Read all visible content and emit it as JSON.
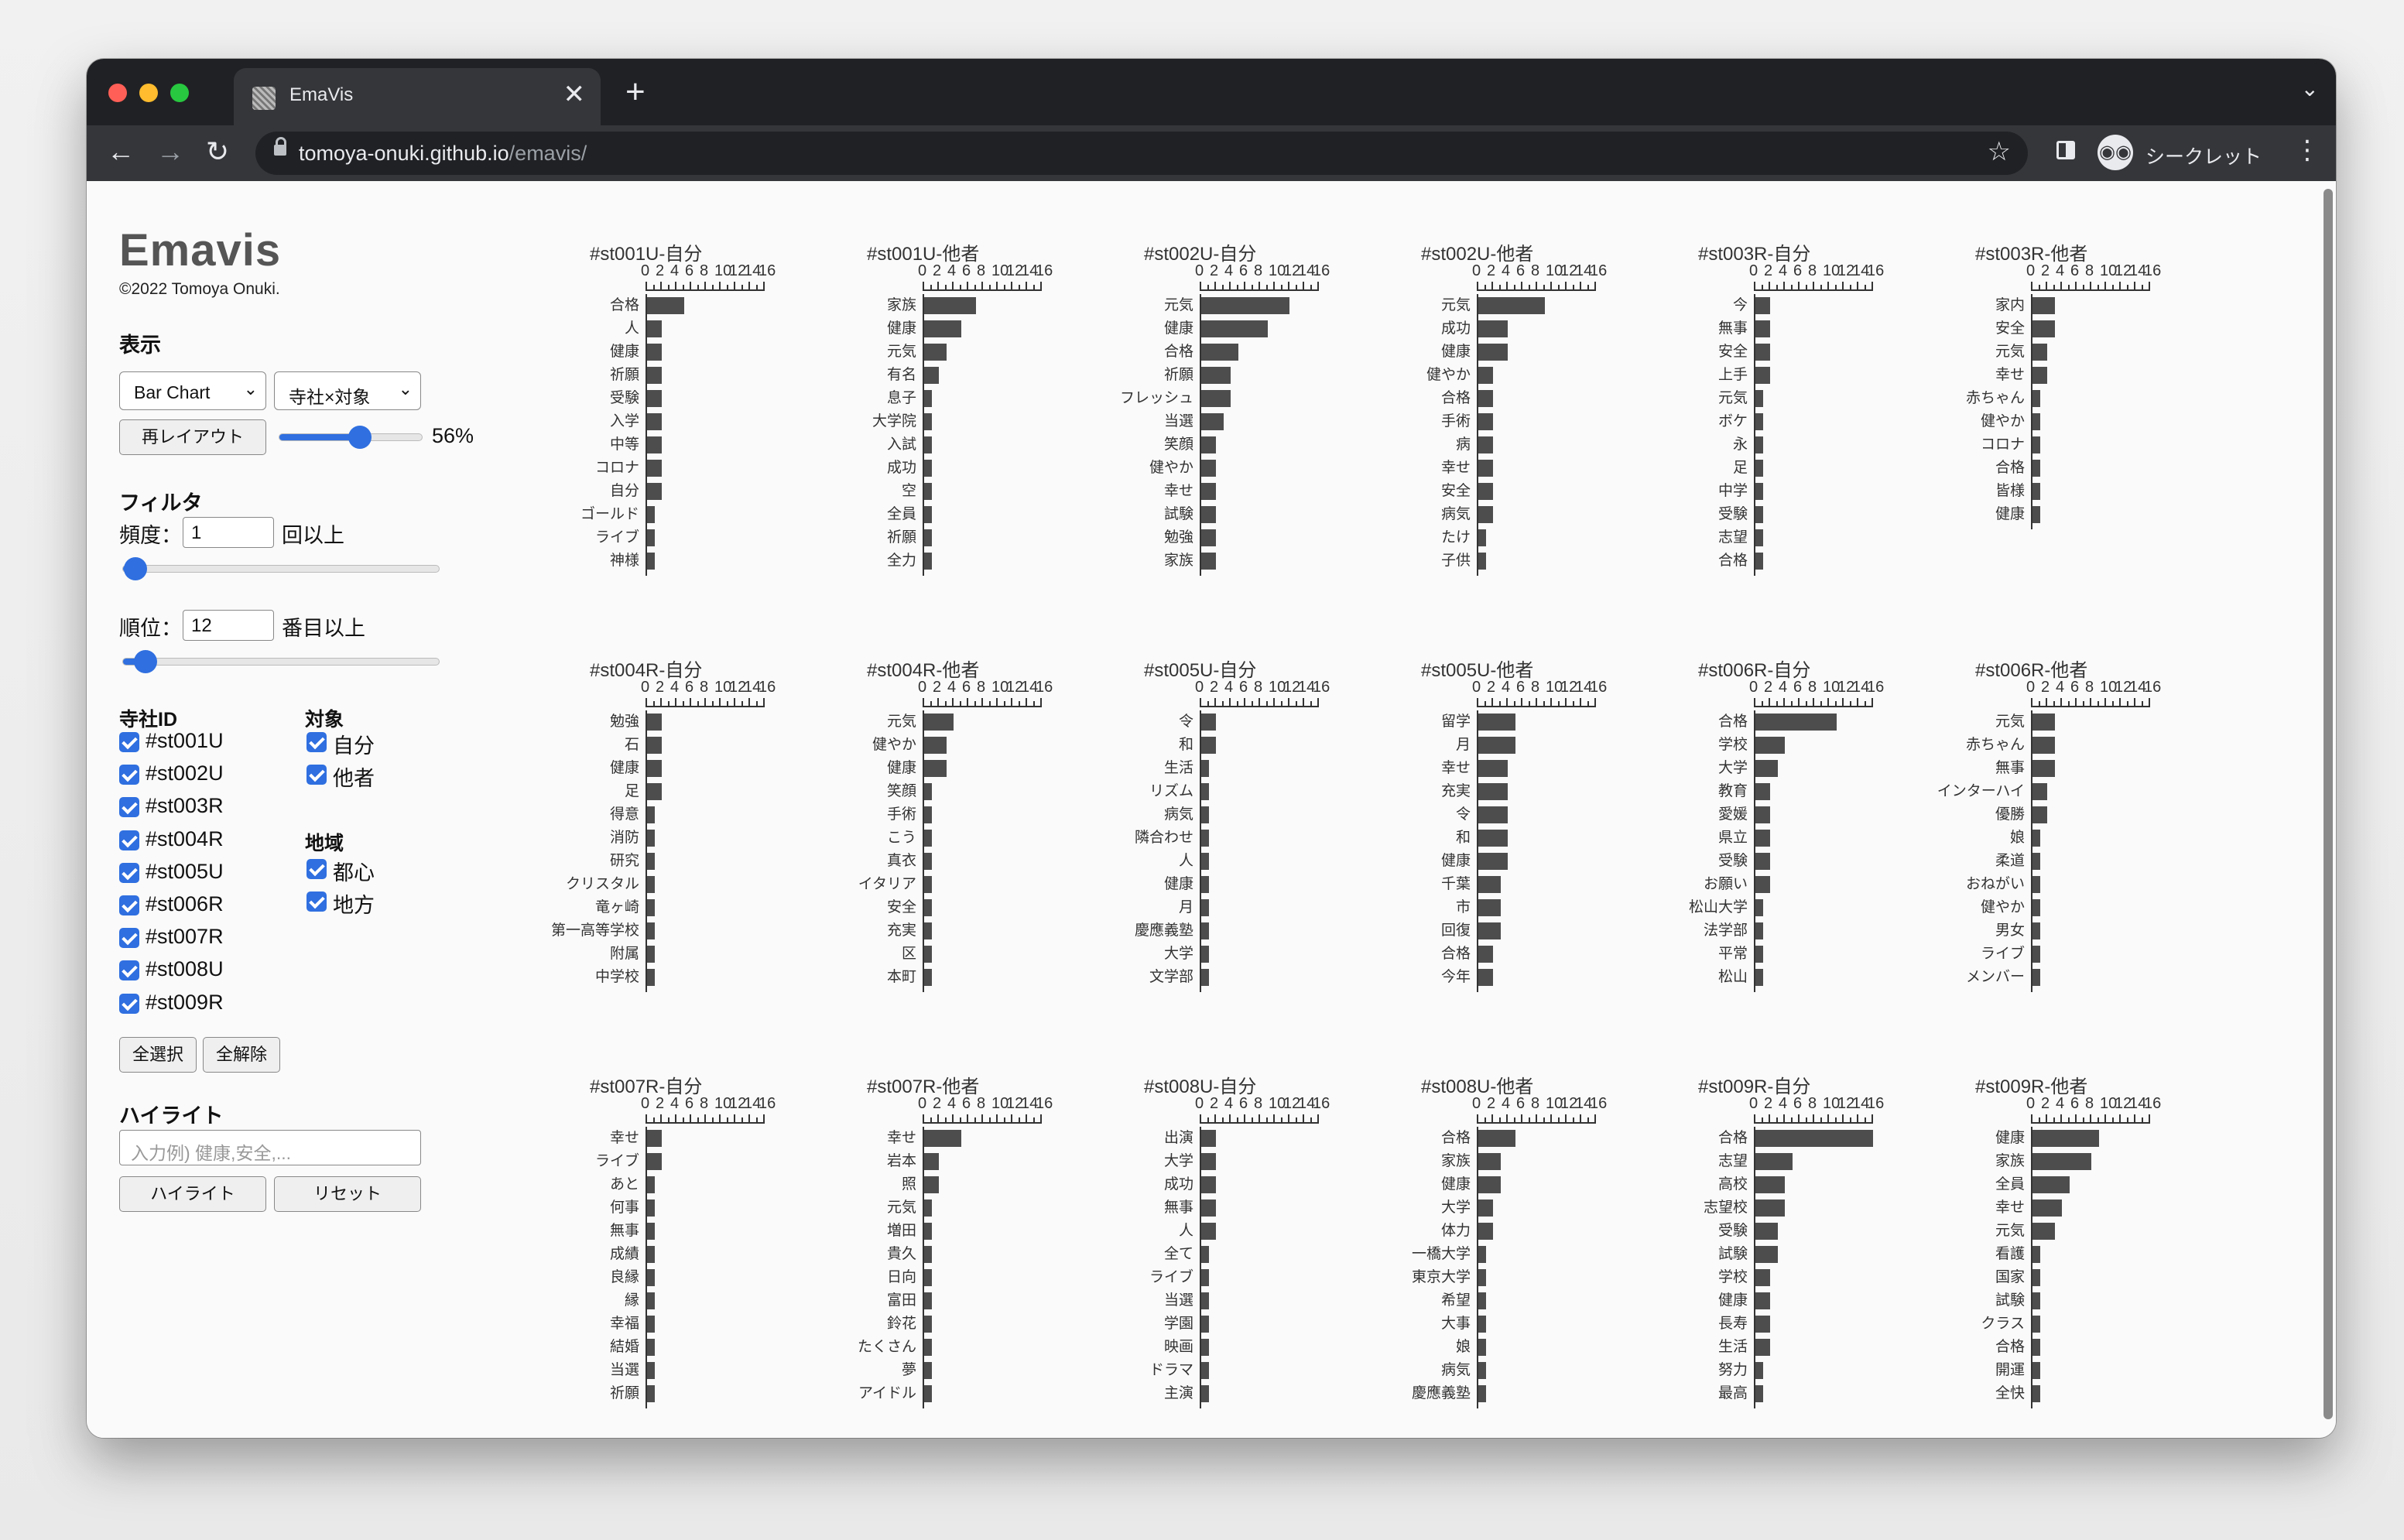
{
  "browser": {
    "tab_title": "EmaVis",
    "tab_close": "✕",
    "new_tab": "+",
    "tab_list": "⌄",
    "back": "←",
    "forward": "→",
    "reload": "↻",
    "url_host": "tomoya-onuki.github.io",
    "url_path": "/emavis/",
    "star": "☆",
    "incognito_icon": "◉◉",
    "incognito_label": "シークレット",
    "menu": "⋮",
    "colors": {
      "frame": "#202124",
      "toolbar": "#35363a",
      "close": "#ff5f57",
      "min": "#febc2e",
      "max": "#28c840"
    }
  },
  "controls": {
    "title": "Emavis",
    "copyright": "©2022 Tomoya Onuki.",
    "display_label": "表示",
    "chart_type": "Bar Chart",
    "grouping": "寺社×対象",
    "relayout_button": "再レイアウト",
    "zoom_value": 0.56,
    "zoom_text": "56%",
    "filter_label": "フィルタ",
    "freq_label": "頻度：",
    "freq_value": "1",
    "freq_suffix": "回以上",
    "freq_slider": 0.04,
    "rank_label": "順位：",
    "rank_value": "12",
    "rank_suffix": "番目以上",
    "rank_slider": 0.07,
    "shrine_header": "寺社ID",
    "shrines": [
      "#st001U",
      "#st002U",
      "#st003R",
      "#st004R",
      "#st005U",
      "#st006R",
      "#st007R",
      "#st008U",
      "#st009R"
    ],
    "target_header": "対象",
    "targets": [
      "自分",
      "他者"
    ],
    "region_header": "地域",
    "regions": [
      "都心",
      "地方"
    ],
    "select_all": "全選択",
    "clear_all": "全解除",
    "highlight_label": "ハイライト",
    "highlight_placeholder": "入力例) 健康,安全,...",
    "highlight_button": "ハイライト",
    "reset_button": "リセット"
  },
  "chart_data": {
    "type": "bar",
    "orientation": "horizontal",
    "x_ticks": [
      "0",
      "2",
      "4",
      "6",
      "8",
      "10",
      "12",
      "14",
      "16"
    ],
    "xlim": [
      0,
      16
    ],
    "bar_color": "#4d4d4d",
    "charts": [
      {
        "title": "#st001U-自分",
        "categories": [
          "合格",
          "人",
          "健康",
          "祈願",
          "受験",
          "入学",
          "中等",
          "コロナ",
          "自分",
          "ゴールド",
          "ライブ",
          "神様"
        ],
        "values": [
          5,
          2,
          2,
          2,
          2,
          2,
          2,
          2,
          2,
          1,
          1,
          1
        ]
      },
      {
        "title": "#st001U-他者",
        "categories": [
          "家族",
          "健康",
          "元気",
          "有名",
          "息子",
          "大学院",
          "入試",
          "成功",
          "空",
          "全員",
          "祈願",
          "全力"
        ],
        "values": [
          7,
          5,
          3,
          2,
          1,
          1,
          1,
          1,
          1,
          1,
          1,
          1
        ]
      },
      {
        "title": "#st002U-自分",
        "categories": [
          "元気",
          "健康",
          "合格",
          "祈願",
          "フレッシュ",
          "当選",
          "笑顔",
          "健やか",
          "幸せ",
          "試験",
          "勉強",
          "家族"
        ],
        "values": [
          12,
          9,
          5,
          4,
          4,
          3,
          2,
          2,
          2,
          2,
          2,
          2
        ]
      },
      {
        "title": "#st002U-他者",
        "categories": [
          "元気",
          "成功",
          "健康",
          "健やか",
          "合格",
          "手術",
          "病",
          "幸せ",
          "安全",
          "病気",
          "たけ",
          "子供"
        ],
        "values": [
          9,
          4,
          4,
          2,
          2,
          2,
          2,
          2,
          2,
          2,
          1,
          1
        ]
      },
      {
        "title": "#st003R-自分",
        "categories": [
          "今",
          "無事",
          "安全",
          "上手",
          "元気",
          "ボケ",
          "永",
          "足",
          "中学",
          "受験",
          "志望",
          "合格"
        ],
        "values": [
          2,
          2,
          2,
          2,
          1,
          1,
          1,
          1,
          1,
          1,
          1,
          1
        ]
      },
      {
        "title": "#st003R-他者",
        "categories": [
          "家内",
          "安全",
          "元気",
          "幸せ",
          "赤ちゃん",
          "健やか",
          "コロナ",
          "合格",
          "皆様",
          "健康"
        ],
        "values": [
          3,
          3,
          2,
          2,
          1,
          1,
          1,
          1,
          1,
          1
        ]
      },
      {
        "title": "#st004R-自分",
        "categories": [
          "勉強",
          "石",
          "健康",
          "足",
          "得意",
          "消防",
          "研究",
          "クリスタル",
          "竜ヶ崎",
          "第一高等学校",
          "附属",
          "中学校"
        ],
        "values": [
          2,
          2,
          2,
          2,
          1,
          1,
          1,
          1,
          1,
          1,
          1,
          1
        ]
      },
      {
        "title": "#st004R-他者",
        "categories": [
          "元気",
          "健やか",
          "健康",
          "笑顔",
          "手術",
          "こう",
          "真衣",
          "イタリア",
          "安全",
          "充実",
          "区",
          "本町"
        ],
        "values": [
          4,
          3,
          3,
          1,
          1,
          1,
          1,
          1,
          1,
          1,
          1,
          1
        ]
      },
      {
        "title": "#st005U-自分",
        "categories": [
          "令",
          "和",
          "生活",
          "リズム",
          "病気",
          "隣合わせ",
          "人",
          "健康",
          "月",
          "慶應義塾",
          "大学",
          "文学部"
        ],
        "values": [
          2,
          2,
          1,
          1,
          1,
          1,
          1,
          1,
          1,
          1,
          1,
          1
        ]
      },
      {
        "title": "#st005U-他者",
        "categories": [
          "留学",
          "月",
          "幸せ",
          "充実",
          "令",
          "和",
          "健康",
          "千葉",
          "市",
          "回復",
          "合格",
          "今年"
        ],
        "values": [
          5,
          5,
          4,
          4,
          4,
          4,
          4,
          3,
          3,
          3,
          2,
          2
        ]
      },
      {
        "title": "#st006R-自分",
        "categories": [
          "合格",
          "学校",
          "大学",
          "教育",
          "愛媛",
          "県立",
          "受験",
          "お願い",
          "松山大学",
          "法学部",
          "平常",
          "松山"
        ],
        "values": [
          11,
          4,
          3,
          2,
          2,
          2,
          2,
          2,
          1,
          1,
          1,
          1
        ]
      },
      {
        "title": "#st006R-他者",
        "categories": [
          "元気",
          "赤ちゃん",
          "無事",
          "インターハイ",
          "優勝",
          "娘",
          "柔道",
          "おねがい",
          "健やか",
          "男女",
          "ライブ",
          "メンバー"
        ],
        "values": [
          3,
          3,
          3,
          2,
          2,
          1,
          1,
          1,
          1,
          1,
          1,
          1
        ]
      },
      {
        "title": "#st007R-自分",
        "categories": [
          "幸せ",
          "ライブ",
          "あと",
          "何事",
          "無事",
          "成績",
          "良縁",
          "縁",
          "幸福",
          "結婚",
          "当選",
          "祈願"
        ],
        "values": [
          2,
          2,
          1,
          1,
          1,
          1,
          1,
          1,
          1,
          1,
          1,
          1
        ]
      },
      {
        "title": "#st007R-他者",
        "categories": [
          "幸せ",
          "岩本",
          "照",
          "元気",
          "増田",
          "貴久",
          "日向",
          "富田",
          "鈴花",
          "たくさん",
          "夢",
          "アイドル"
        ],
        "values": [
          5,
          2,
          2,
          1,
          1,
          1,
          1,
          1,
          1,
          1,
          1,
          1
        ]
      },
      {
        "title": "#st008U-自分",
        "categories": [
          "出演",
          "大学",
          "成功",
          "無事",
          "人",
          "全て",
          "ライブ",
          "当選",
          "学園",
          "映画",
          "ドラマ",
          "主演"
        ],
        "values": [
          2,
          2,
          2,
          2,
          2,
          1,
          1,
          1,
          1,
          1,
          1,
          1
        ]
      },
      {
        "title": "#st008U-他者",
        "categories": [
          "合格",
          "家族",
          "健康",
          "大学",
          "体力",
          "一橋大学",
          "東京大学",
          "希望",
          "大事",
          "娘",
          "病気",
          "慶應義塾"
        ],
        "values": [
          5,
          3,
          3,
          2,
          2,
          1,
          1,
          1,
          1,
          1,
          1,
          1
        ]
      },
      {
        "title": "#st009R-自分",
        "categories": [
          "合格",
          "志望",
          "高校",
          "志望校",
          "受験",
          "試験",
          "学校",
          "健康",
          "長寿",
          "生活",
          "努力",
          "最高"
        ],
        "values": [
          16,
          5,
          4,
          4,
          3,
          3,
          2,
          2,
          2,
          2,
          1,
          1
        ]
      },
      {
        "title": "#st009R-他者",
        "categories": [
          "健康",
          "家族",
          "全員",
          "幸せ",
          "元気",
          "看護",
          "国家",
          "試験",
          "クラス",
          "合格",
          "開運",
          "全快"
        ],
        "values": [
          9,
          8,
          5,
          4,
          3,
          1,
          1,
          1,
          1,
          1,
          1,
          1
        ]
      }
    ]
  }
}
